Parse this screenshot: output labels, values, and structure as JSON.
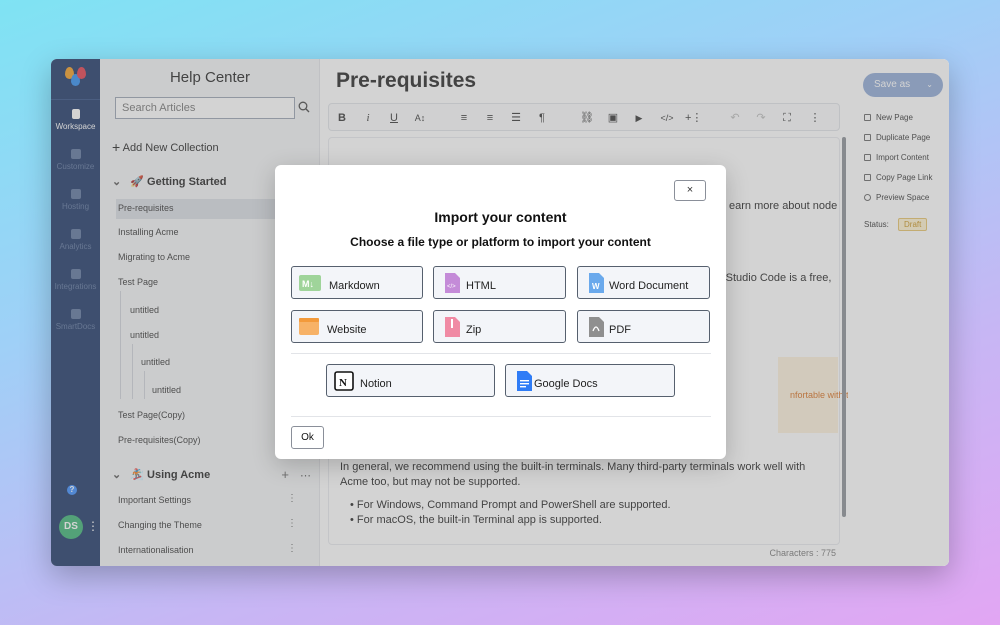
{
  "rail": {
    "items": [
      {
        "label": "Workspace",
        "icon": "document-icon",
        "active": true
      },
      {
        "label": "Customize",
        "icon": "paint-roller-icon"
      },
      {
        "label": "Hosting",
        "icon": "server-icon"
      },
      {
        "label": "Analytics",
        "icon": "chart-icon"
      },
      {
        "label": "Integrations",
        "icon": "puzzle-icon"
      },
      {
        "label": "SmartDocs",
        "icon": "robot-icon"
      }
    ],
    "help": "?",
    "avatar": "DS"
  },
  "sidebar": {
    "title": "Help Center",
    "search_placeholder": "Search Articles",
    "add_collection": "Add New Collection",
    "sections": [
      {
        "label": "🚀 Getting Started"
      },
      {
        "label": "🏂 Using Acme"
      }
    ],
    "items": [
      "Pre-requisites",
      "Installing Acme",
      "Migrating to Acme",
      "Test Page",
      "untitled",
      "untitled",
      "untitled",
      "untitled",
      "Test Page(Copy)",
      "Pre-requisites(Copy)",
      "Important Settings",
      "Changing the Theme",
      "Internationalisation"
    ]
  },
  "editor": {
    "title": "Pre-requisites",
    "toolbar_icons": [
      "bold-icon",
      "italic-icon",
      "underline-icon",
      "font-size-icon",
      "align-left-icon",
      "align-center-icon",
      "list-icon",
      "paragraph-icon",
      "link-icon",
      "image-icon",
      "video-icon",
      "code-icon",
      "insert-icon",
      "undo-icon",
      "redo-icon",
      "fullscreen-icon",
      "more-icon"
    ],
    "toolbar_glyphs": [
      "B",
      "i",
      "U",
      "A↕",
      "≡",
      "≡",
      "☰",
      "¶",
      "⛓",
      "▣",
      "▶",
      "</>",
      "+⋮",
      "↶",
      "↷",
      "⛶",
      "⋮"
    ],
    "snip1": "earn more about node",
    "snip2": "al Studio Code is a free,",
    "callout_snip": "nfortable with the",
    "para": "In general, we recommend using the built-in terminals. Many third-party terminals work well with Acme too, but may not be supported.",
    "bullets": [
      "For Windows, Command Prompt and PowerShell are supported.",
      "For macOS, the built-in Terminal app is supported."
    ],
    "char_count": "Characters : 775"
  },
  "right_panel": {
    "save_label": "Save as",
    "items": [
      "New Page",
      "Duplicate Page",
      "Import Content",
      "Copy Page Link",
      "Preview Space"
    ],
    "status_label": "Status:",
    "status_value": "Draft"
  },
  "modal": {
    "close": "×",
    "title": "Import your content",
    "subtitle": "Choose a file type or platform to import your content",
    "options": [
      "Markdown",
      "HTML",
      "Word Document",
      "Website",
      "Zip",
      "PDF",
      "Notion",
      "Google Docs"
    ],
    "ok": "Ok"
  },
  "colors": {
    "rail_bg": "#1b3566",
    "accent": "#8fa9d6",
    "draft": "#c9931c"
  }
}
